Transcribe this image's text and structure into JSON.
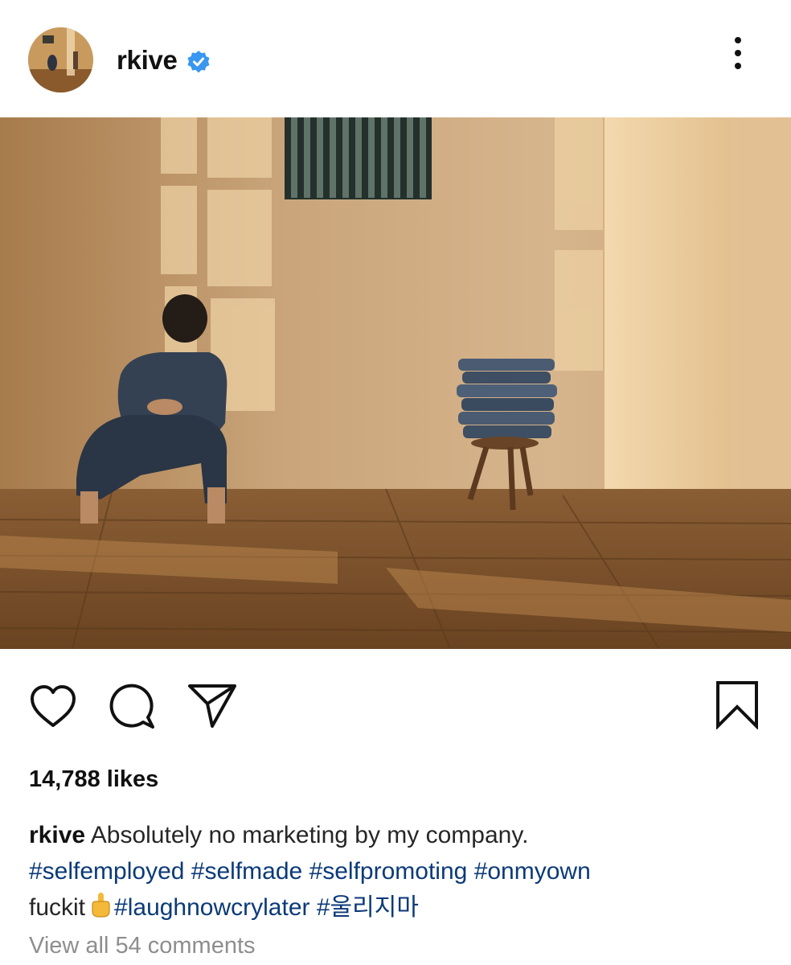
{
  "post": {
    "username": "rkive",
    "verified": true,
    "likes_text": "14,788 likes",
    "caption": {
      "username": "rkive",
      "line1": "Absolutely no marketing by my company.",
      "hashtags_line2": [
        "#selfemployed",
        "#selfmade",
        "#selfpromoting",
        "#onmyown"
      ],
      "line3_text": "fuckit",
      "line3_hashtags": [
        "#laughnowcrylater",
        "#울리지마"
      ]
    },
    "view_comments": "View all 54 comments"
  },
  "icons": {
    "more": "more-options-icon",
    "verified": "verified-badge-icon",
    "like": "heart-icon",
    "comment": "comment-icon",
    "share": "paper-plane-icon",
    "save": "bookmark-icon",
    "emoji": "middle-finger-emoji"
  },
  "colors": {
    "hashtag": "#0b3a78",
    "verified": "#3897f0",
    "muted": "#8e8e8e"
  }
}
